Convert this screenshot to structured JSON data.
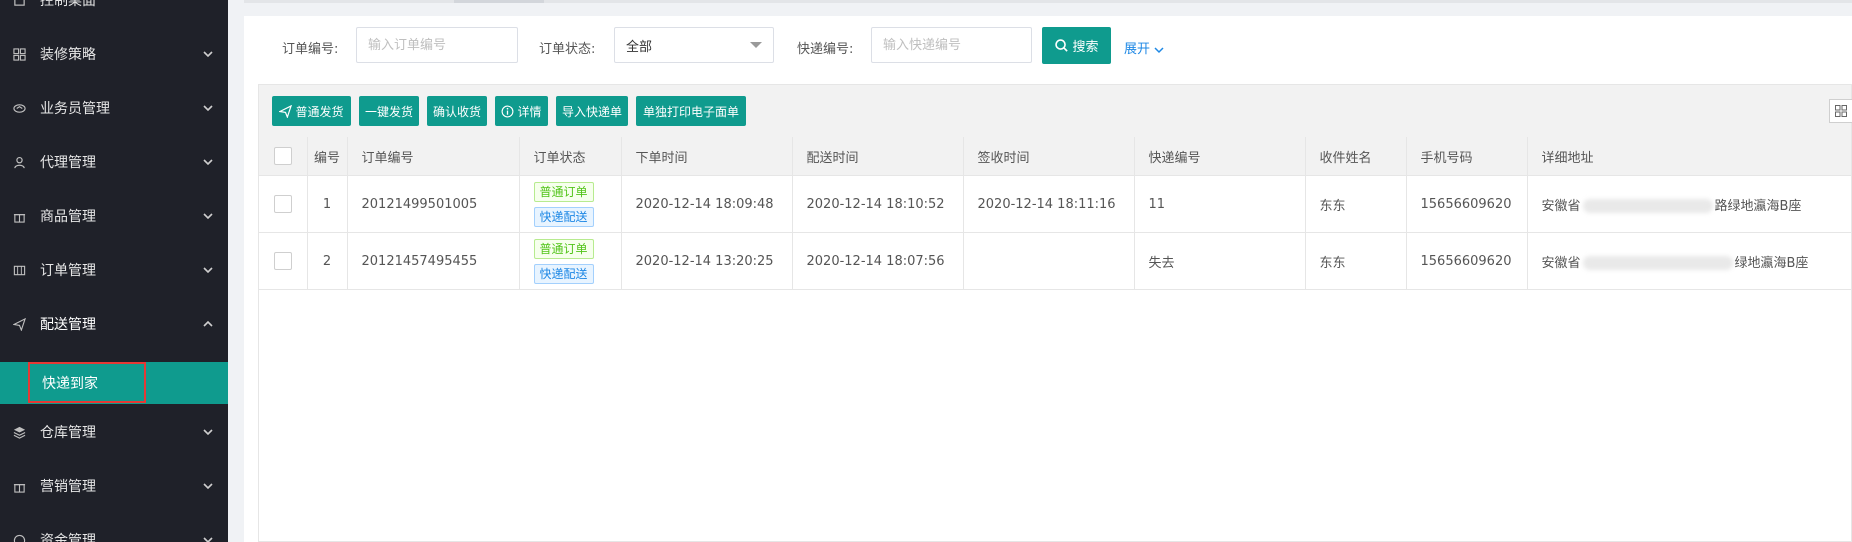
{
  "sidebar": {
    "items": [
      {
        "label": "控制桌面",
        "icon": "home-icon"
      },
      {
        "label": "装修策略",
        "icon": "apps-icon"
      },
      {
        "label": "业务员管理",
        "icon": "handshake-icon"
      },
      {
        "label": "代理管理",
        "icon": "user-icon"
      },
      {
        "label": "商品管理",
        "icon": "gift-icon"
      },
      {
        "label": "订单管理",
        "icon": "table-icon"
      },
      {
        "label": "配送管理",
        "icon": "send-icon"
      },
      {
        "label": "仓库管理",
        "icon": "layers-icon"
      },
      {
        "label": "营销管理",
        "icon": "gift-icon"
      },
      {
        "label": "资金管理",
        "icon": "coin-icon"
      }
    ],
    "active_sub": "快递到家"
  },
  "search": {
    "order_no_label": "订单编号:",
    "order_no_placeholder": "输入订单编号",
    "status_label": "订单状态:",
    "status_value": "全部",
    "express_label": "快递编号:",
    "express_placeholder": "输入快递编号",
    "search_button": "搜索",
    "expand_label": "展开"
  },
  "toolbar": {
    "normal_ship": "普通发货",
    "one_click_ship": "一键发货",
    "confirm_receipt": "确认收货",
    "details": "详情",
    "import_express": "导入快递单",
    "print_waybill": "单独打印电子面单"
  },
  "table": {
    "headers": [
      "编号",
      "订单编号",
      "订单状态",
      "下单时间",
      "配送时间",
      "签收时间",
      "快递编号",
      "收件姓名",
      "手机号码",
      "详细地址"
    ],
    "rows": [
      {
        "num": "1",
        "order_no": "20121499501005",
        "tag1": "普通订单",
        "tag2": "快递配送",
        "order_time": "2020-12-14 18:09:48",
        "ship_time": "2020-12-14 18:10:52",
        "sign_time": "2020-12-14 18:11:16",
        "express_no": "11",
        "name": "东东",
        "phone": "15656609620",
        "addr_start": "安徽省",
        "addr_end": "路绿地瀛海B座"
      },
      {
        "num": "2",
        "order_no": "20121457495455",
        "tag1": "普通订单",
        "tag2": "快递配送",
        "order_time": "2020-12-14 13:20:25",
        "ship_time": "2020-12-14 18:07:56",
        "sign_time": "",
        "express_no": "失去",
        "name": "东东",
        "phone": "15656609620",
        "addr_start": "安徽省",
        "addr_end": "绿地瀛海B座"
      }
    ]
  },
  "colors": {
    "accent": "#0f9b8e",
    "sidebar_bg": "#1f2129",
    "link": "#1e88e5",
    "highlight": "#e53935"
  }
}
